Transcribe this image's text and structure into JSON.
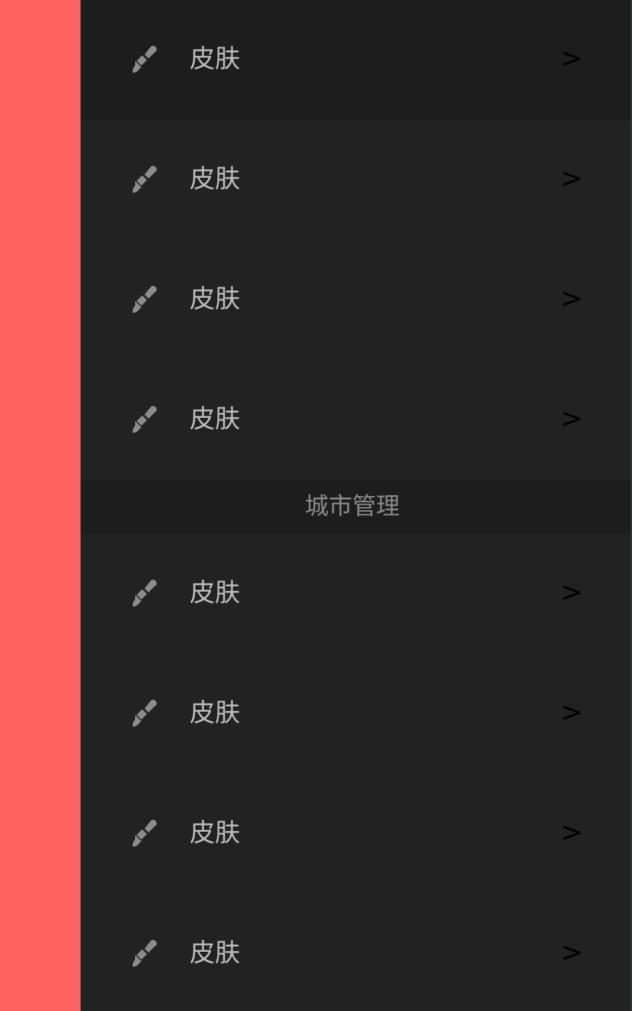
{
  "theme": {
    "accent_left": "#ff6261",
    "background": "#222222",
    "top_row_bg": "#1d1d1d",
    "text": "#bfbfbf",
    "section_text": "#8b8b8b",
    "chevron": "#000000"
  },
  "menu": {
    "groups": [
      {
        "items": [
          {
            "icon": "brush-icon",
            "label": "皮肤",
            "chevron": ">"
          },
          {
            "icon": "brush-icon",
            "label": "皮肤",
            "chevron": ">"
          },
          {
            "icon": "brush-icon",
            "label": "皮肤",
            "chevron": ">"
          },
          {
            "icon": "brush-icon",
            "label": "皮肤",
            "chevron": ">"
          }
        ]
      },
      {
        "section_title": "城市管理",
        "items": [
          {
            "icon": "brush-icon",
            "label": "皮肤",
            "chevron": ">"
          },
          {
            "icon": "brush-icon",
            "label": "皮肤",
            "chevron": ">"
          },
          {
            "icon": "brush-icon",
            "label": "皮肤",
            "chevron": ">"
          },
          {
            "icon": "brush-icon",
            "label": "皮肤",
            "chevron": ">"
          }
        ]
      }
    ]
  }
}
